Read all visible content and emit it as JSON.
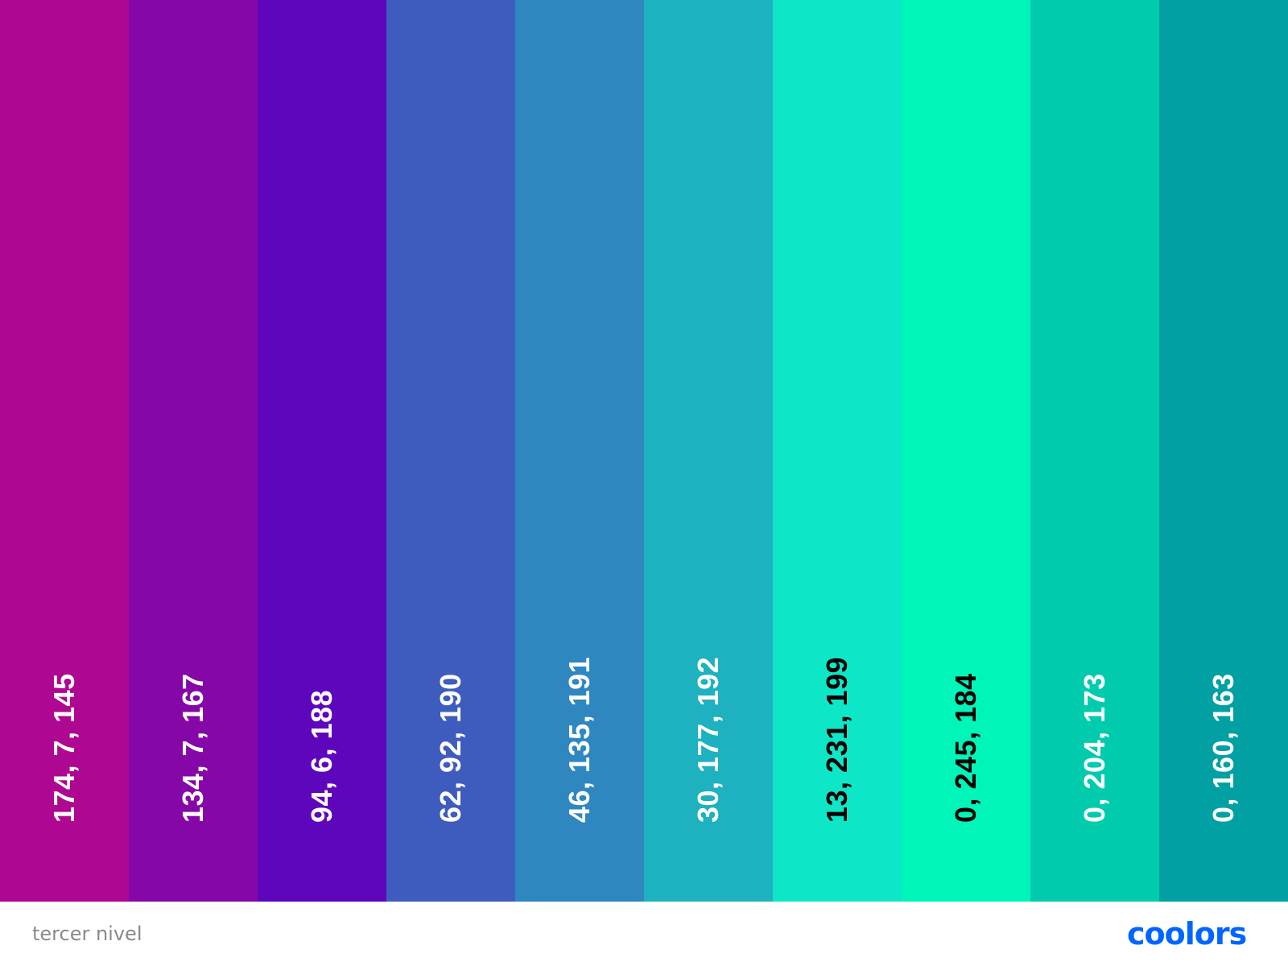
{
  "palette": {
    "swatches": [
      {
        "label": "174, 7, 145",
        "color": "#ae0791",
        "text_color": "#ffffff"
      },
      {
        "label": "134, 7, 167",
        "color": "#8607a7",
        "text_color": "#ffffff"
      },
      {
        "label": "94, 6, 188",
        "color": "#5e06bc",
        "text_color": "#ffffff"
      },
      {
        "label": "62, 92, 190",
        "color": "#3e5cbe",
        "text_color": "#ffffff"
      },
      {
        "label": "46, 135, 191",
        "color": "#2e87bf",
        "text_color": "#ffffff"
      },
      {
        "label": "30, 177, 192",
        "color": "#1eb1c0",
        "text_color": "#ffffff"
      },
      {
        "label": "13, 231, 199",
        "color": "#0de7c7",
        "text_color": "#000000"
      },
      {
        "label": "0, 245, 184",
        "color": "#00f5b8",
        "text_color": "#000000"
      },
      {
        "label": "0, 204, 173",
        "color": "#00ccad",
        "text_color": "#ffffff"
      },
      {
        "label": "0, 160, 163",
        "color": "#00a0a3",
        "text_color": "#ffffff"
      }
    ]
  },
  "footer": {
    "palette_name": "tercer nivel",
    "brand": "coolors",
    "brand_color": "#0066ff"
  }
}
